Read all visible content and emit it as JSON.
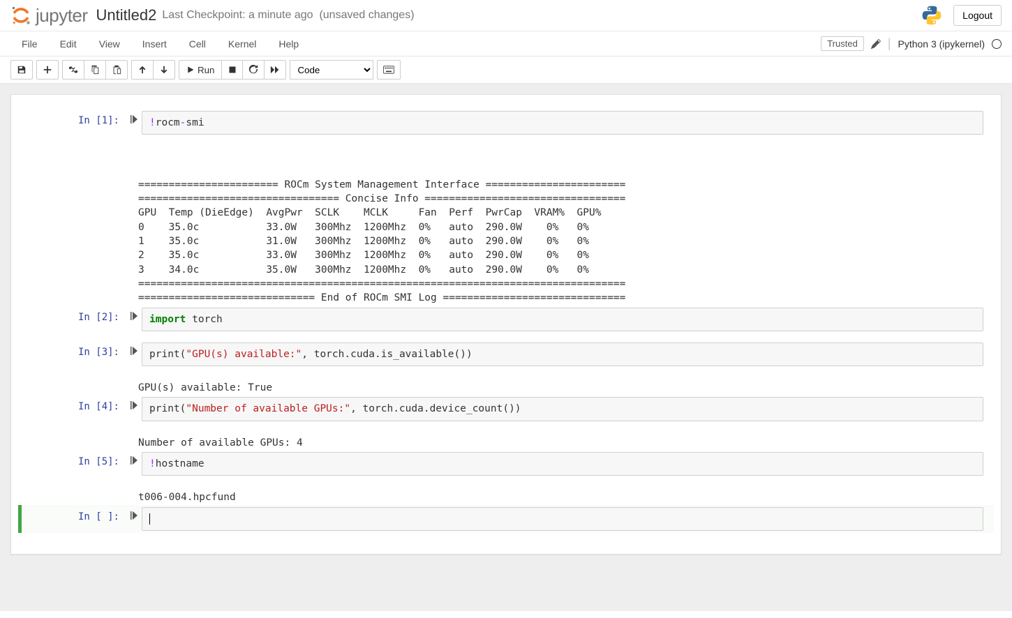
{
  "header": {
    "logo_text": "jupyter",
    "title": "Untitled2",
    "checkpoint_prefix": "Last Checkpoint:",
    "checkpoint_time": "a minute ago",
    "unsaved": "(unsaved changes)",
    "logout": "Logout"
  },
  "menubar": {
    "items": [
      "File",
      "Edit",
      "View",
      "Insert",
      "Cell",
      "Kernel",
      "Help"
    ],
    "trusted": "Trusted",
    "kernel": "Python 3 (ipykernel)"
  },
  "toolbar": {
    "run_label": "Run",
    "celltype": "Code"
  },
  "cells": [
    {
      "prompt": "In [1]:",
      "code_html": "<span class='sp-op'>!</span>rocm<span class='sp-op'>-</span>smi",
      "output": "\n\n======================= ROCm System Management Interface =======================\n================================= Concise Info =================================\nGPU  Temp (DieEdge)  AvgPwr  SCLK    MCLK     Fan  Perf  PwrCap  VRAM%  GPU%\n0    35.0c           33.0W   300Mhz  1200Mhz  0%   auto  290.0W    0%   0%\n1    35.0c           31.0W   300Mhz  1200Mhz  0%   auto  290.0W    0%   0%\n2    35.0c           33.0W   300Mhz  1200Mhz  0%   auto  290.0W    0%   0%\n3    34.0c           35.0W   300Mhz  1200Mhz  0%   auto  290.0W    0%   0%\n================================================================================\n============================= End of ROCm SMI Log ==============================\n"
    },
    {
      "prompt": "In [2]:",
      "code_html": "<span class='sp-kw'>import</span> torch",
      "output": null
    },
    {
      "prompt": "In [3]:",
      "code_html": "print(<span class='sp-str'>\"GPU(s) available:\"</span>, torch.cuda.is_available())",
      "output": "GPU(s) available: True"
    },
    {
      "prompt": "In [4]:",
      "code_html": "print(<span class='sp-str'>\"Number of available GPUs:\"</span>, torch.cuda.device_count())",
      "output": "Number of available GPUs: 4"
    },
    {
      "prompt": "In [5]:",
      "code_html": "<span class='sp-op'>!</span>hostname",
      "output": "t006-004.hpcfund"
    },
    {
      "prompt": "In [ ]:",
      "code_html": "<span class='cursor-line'></span>",
      "output": null,
      "selected": true
    }
  ]
}
